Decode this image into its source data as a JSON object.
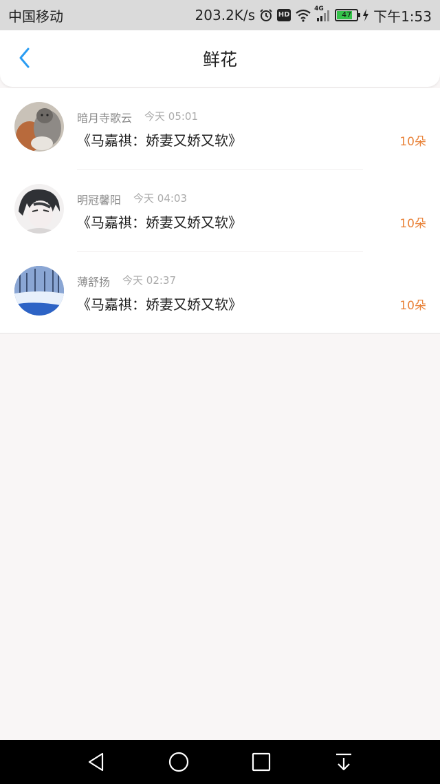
{
  "status_bar": {
    "carrier": "中国移动",
    "net_speed": "203.2K/s",
    "hd": "HD",
    "net_type": "4G",
    "battery": "47",
    "time": "下午1:53"
  },
  "header": {
    "title": "鲜花"
  },
  "items": [
    {
      "username": "暗月寺歌云",
      "time": "今天 05:01",
      "book": "《马嘉祺：娇妻又娇又软》",
      "count": "10朵"
    },
    {
      "username": "明冠馨阳",
      "time": "今天 04:03",
      "book": "《马嘉祺：娇妻又娇又软》",
      "count": "10朵"
    },
    {
      "username": "薄舒扬",
      "time": "今天 02:37",
      "book": "《马嘉祺：娇妻又娇又软》",
      "count": "10朵"
    }
  ],
  "colors": {
    "accent_blue": "#2a9cf2",
    "count_orange": "#e9833a",
    "page_bg": "#f9f6f6"
  },
  "icons": {
    "back": "chevron-left-icon",
    "alarm": "alarm-clock-icon",
    "wifi": "wifi-icon",
    "signal": "signal-icon",
    "charging": "charging-bolt-icon"
  }
}
